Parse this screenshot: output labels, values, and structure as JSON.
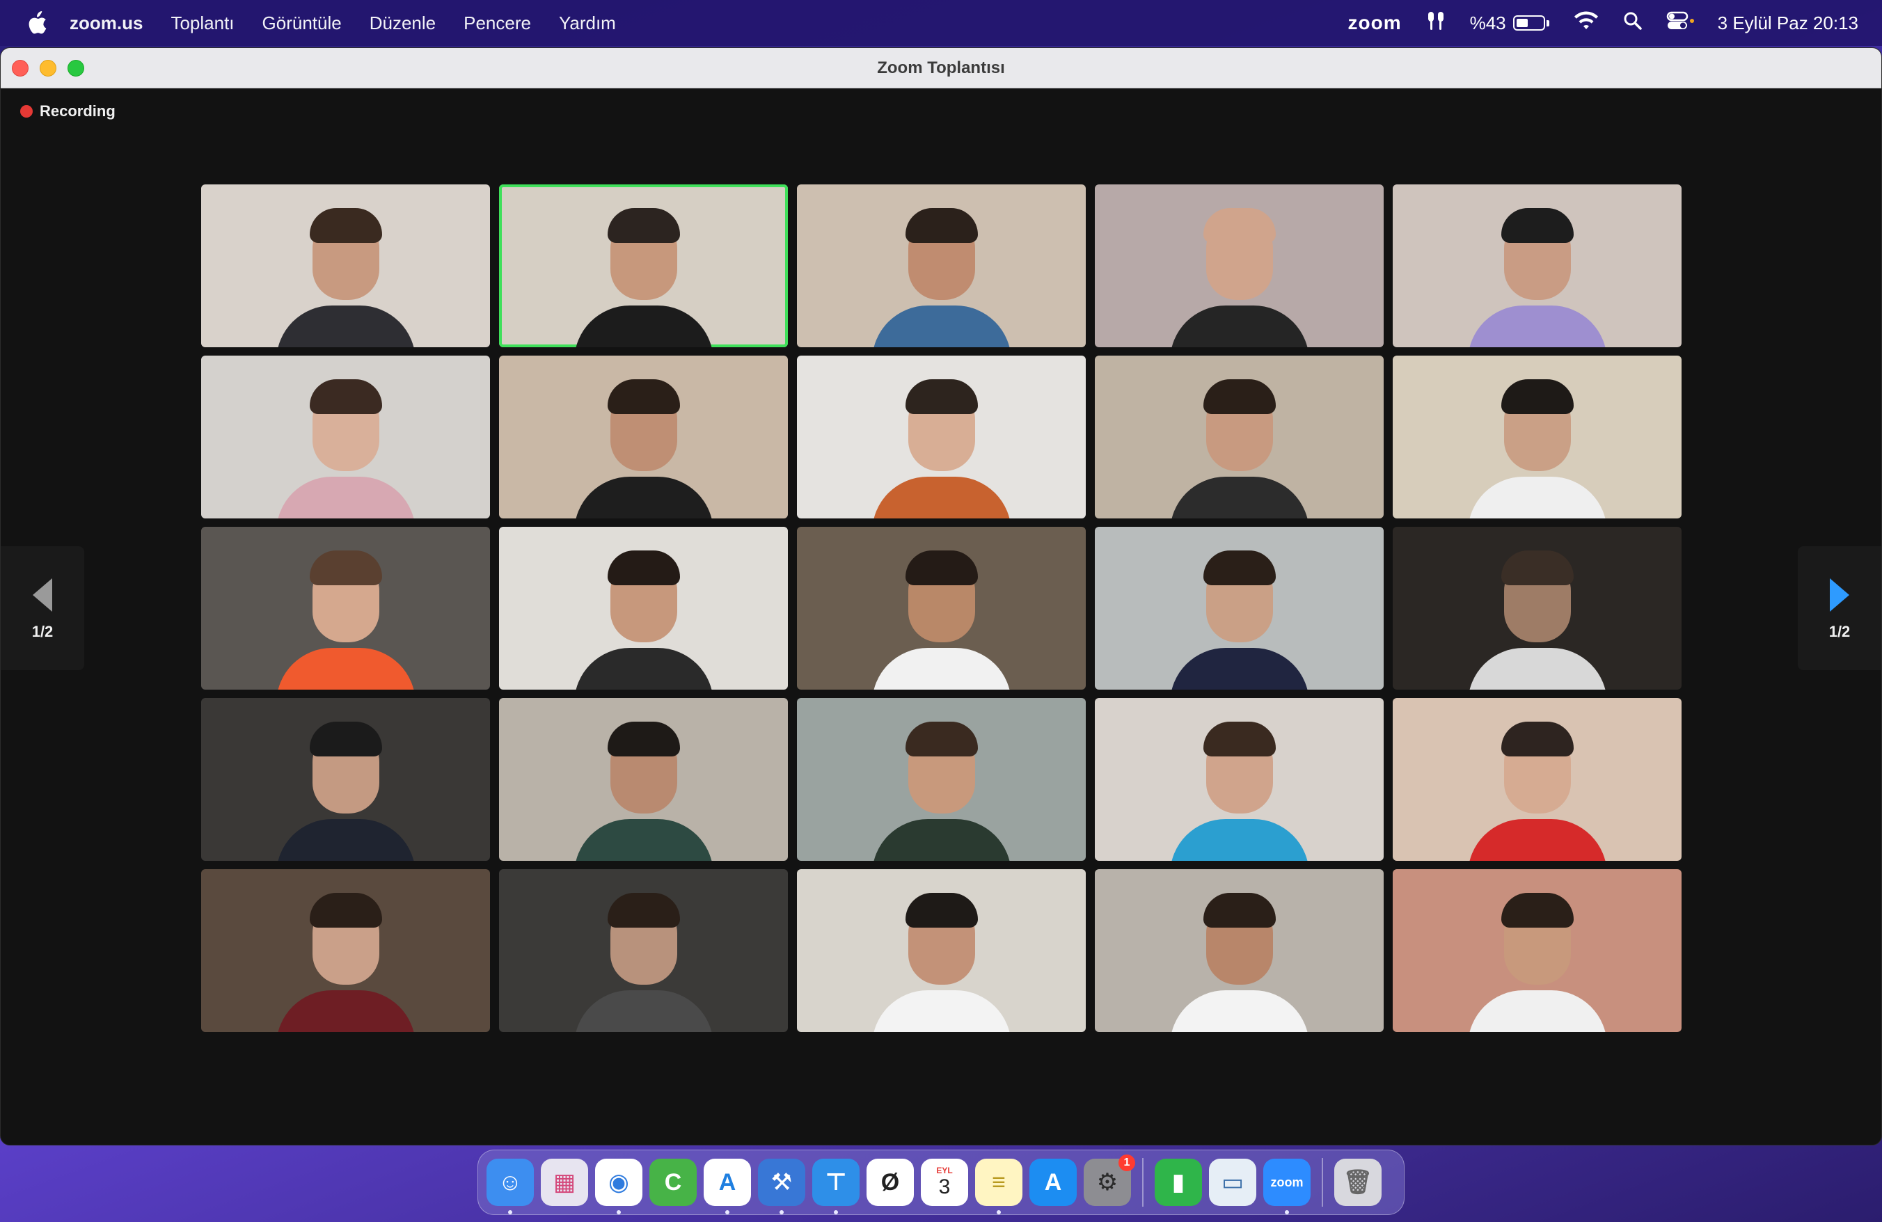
{
  "menubar": {
    "app_name": "zoom.us",
    "items": [
      "Toplantı",
      "Görüntüle",
      "Düzenle",
      "Pencere",
      "Yardım"
    ],
    "zoom_label": "zoom",
    "battery_text": "%43",
    "battery_level": 0.43,
    "date_time": "3 Eylül Paz  20:13"
  },
  "window": {
    "title": "Zoom Toplantısı",
    "recording_label": "Recording",
    "page_left": "1/2",
    "page_right": "1/2"
  },
  "participants": [
    {
      "bg": "#d9d2cb",
      "skin": "#c89a80",
      "hair": "#3a2a20",
      "shirt": "#2e2e33"
    },
    {
      "bg": "#d6cfc4",
      "skin": "#c7987c",
      "hair": "#2c2420",
      "shirt": "#1c1c1c",
      "active": true
    },
    {
      "bg": "#cdbfb0",
      "skin": "#c08c70",
      "hair": "#2b211b",
      "shirt": "#3d6b9a"
    },
    {
      "bg": "#b7a9a8",
      "skin": "#d0a48c",
      "hair": "#d0a48c",
      "shirt": "#252525"
    },
    {
      "bg": "#cfc4bd",
      "skin": "#c99c84",
      "hair": "#1d1d1d",
      "shirt": "#9e8fd0"
    },
    {
      "bg": "#d4d1cd",
      "skin": "#d9b09a",
      "hair": "#3b2a22",
      "shirt": "#d7a8b2"
    },
    {
      "bg": "#c9b8a6",
      "skin": "#bf8f74",
      "hair": "#2a1f18",
      "shirt": "#1e1e1e"
    },
    {
      "bg": "#e5e3e0",
      "skin": "#d8ae95",
      "hair": "#2d241e",
      "shirt": "#c8622f"
    },
    {
      "bg": "#bfb3a3",
      "skin": "#c89a80",
      "hair": "#2a1f18",
      "shirt": "#2c2c2c"
    },
    {
      "bg": "#d7cdbb",
      "skin": "#caa086",
      "hair": "#1e1a17",
      "shirt": "#efefef"
    },
    {
      "bg": "#5a5652",
      "skin": "#d5a88e",
      "hair": "#5a4030",
      "shirt": "#f05a2e"
    },
    {
      "bg": "#e0ddd8",
      "skin": "#c7987c",
      "hair": "#241b16",
      "shirt": "#2a2a2a"
    },
    {
      "bg": "#6b5e50",
      "skin": "#b98868",
      "hair": "#241b16",
      "shirt": "#f1f1f1"
    },
    {
      "bg": "#b8bcbc",
      "skin": "#caa086",
      "hair": "#2a1f18",
      "shirt": "#202540"
    },
    {
      "bg": "#2b2724",
      "skin": "#9e7c66",
      "hair": "#3a2e26",
      "shirt": "#d8d8d8"
    },
    {
      "bg": "#3a3836",
      "skin": "#c49a82",
      "hair": "#1b1b1b",
      "shirt": "#1f2430"
    },
    {
      "bg": "#b9b2a8",
      "skin": "#b98a70",
      "hair": "#1e1a17",
      "shirt": "#2d4a42"
    },
    {
      "bg": "#9aa3a0",
      "skin": "#c8997c",
      "hair": "#3a2a20",
      "shirt": "#2a3a30"
    },
    {
      "bg": "#d8d2cc",
      "skin": "#d0a48c",
      "hair": "#3a2a20",
      "shirt": "#2b9fd0"
    },
    {
      "bg": "#d9c3b2",
      "skin": "#d6ab92",
      "hair": "#2e2420",
      "shirt": "#d62a2a"
    },
    {
      "bg": "#5a4a3e",
      "skin": "#caa089",
      "hair": "#2a1f18",
      "shirt": "#6e1e24"
    },
    {
      "bg": "#3b3a38",
      "skin": "#b8927c",
      "hair": "#2a1f18",
      "shirt": "#4a4a4a"
    },
    {
      "bg": "#d8d4cc",
      "skin": "#c39278",
      "hair": "#1e1a17",
      "shirt": "#f3f3f3"
    },
    {
      "bg": "#b8b2aa",
      "skin": "#b8866a",
      "hair": "#2a1f18",
      "shirt": "#f3f3f3"
    },
    {
      "bg": "#c8907e",
      "skin": "#c8997c",
      "hair": "#2a1f18",
      "shirt": "#f0f0f0"
    }
  ],
  "dock": {
    "apps": [
      {
        "name": "finder-icon",
        "glyph": "☺",
        "bg": "#3d8ef0",
        "fg": "#ffffff",
        "running": true
      },
      {
        "name": "launchpad-icon",
        "glyph": "▦",
        "bg": "#e7e4f0",
        "fg": "#d4477a",
        "running": false
      },
      {
        "name": "chrome-icon",
        "glyph": "◉",
        "bg": "#ffffff",
        "fg": "#2f7bde",
        "running": true
      },
      {
        "name": "camtasia-icon",
        "glyph": "C",
        "bg": "#47b347",
        "fg": "#ffffff",
        "running": false
      },
      {
        "name": "font-book-icon",
        "glyph": "A",
        "bg": "#ffffff",
        "fg": "#1f7fe0",
        "running": true
      },
      {
        "name": "xcode-icon",
        "glyph": "⚒",
        "bg": "#3877d6",
        "fg": "#ffffff",
        "running": true
      },
      {
        "name": "keynote-icon",
        "glyph": "⊤",
        "bg": "#2e8fe8",
        "fg": "#ffffff",
        "running": true
      },
      {
        "name": "scrobbles-icon",
        "glyph": "Ø",
        "bg": "#ffffff",
        "fg": "#222222",
        "running": false
      },
      {
        "name": "calendar-icon",
        "glyph": "3",
        "bg": "#ffffff",
        "fg": "#222222",
        "running": false,
        "top": "EYL"
      },
      {
        "name": "notes-icon",
        "glyph": "≡",
        "bg": "#fff5c2",
        "fg": "#b89a20",
        "running": true
      },
      {
        "name": "app-store-icon",
        "glyph": "A",
        "bg": "#1c8df2",
        "fg": "#ffffff",
        "running": false
      },
      {
        "name": "system-settings-icon",
        "glyph": "⚙",
        "bg": "#8d8d92",
        "fg": "#2a2a2a",
        "running": false,
        "badge": "1"
      }
    ],
    "apps_after": [
      {
        "name": "numbers-icon",
        "glyph": "▮",
        "bg": "#2fb54a",
        "fg": "#ffffff",
        "running": false
      },
      {
        "name": "preview-icon",
        "glyph": "▭",
        "bg": "#e6eef6",
        "fg": "#3a6ea8",
        "running": false
      },
      {
        "name": "zoom-icon",
        "glyph": "zoom",
        "bg": "#2d8cff",
        "fg": "#ffffff",
        "running": true
      }
    ],
    "trash": {
      "name": "trash-icon",
      "glyph": "🗑",
      "bg": "#d8d8de",
      "fg": "#666666",
      "running": false
    }
  }
}
